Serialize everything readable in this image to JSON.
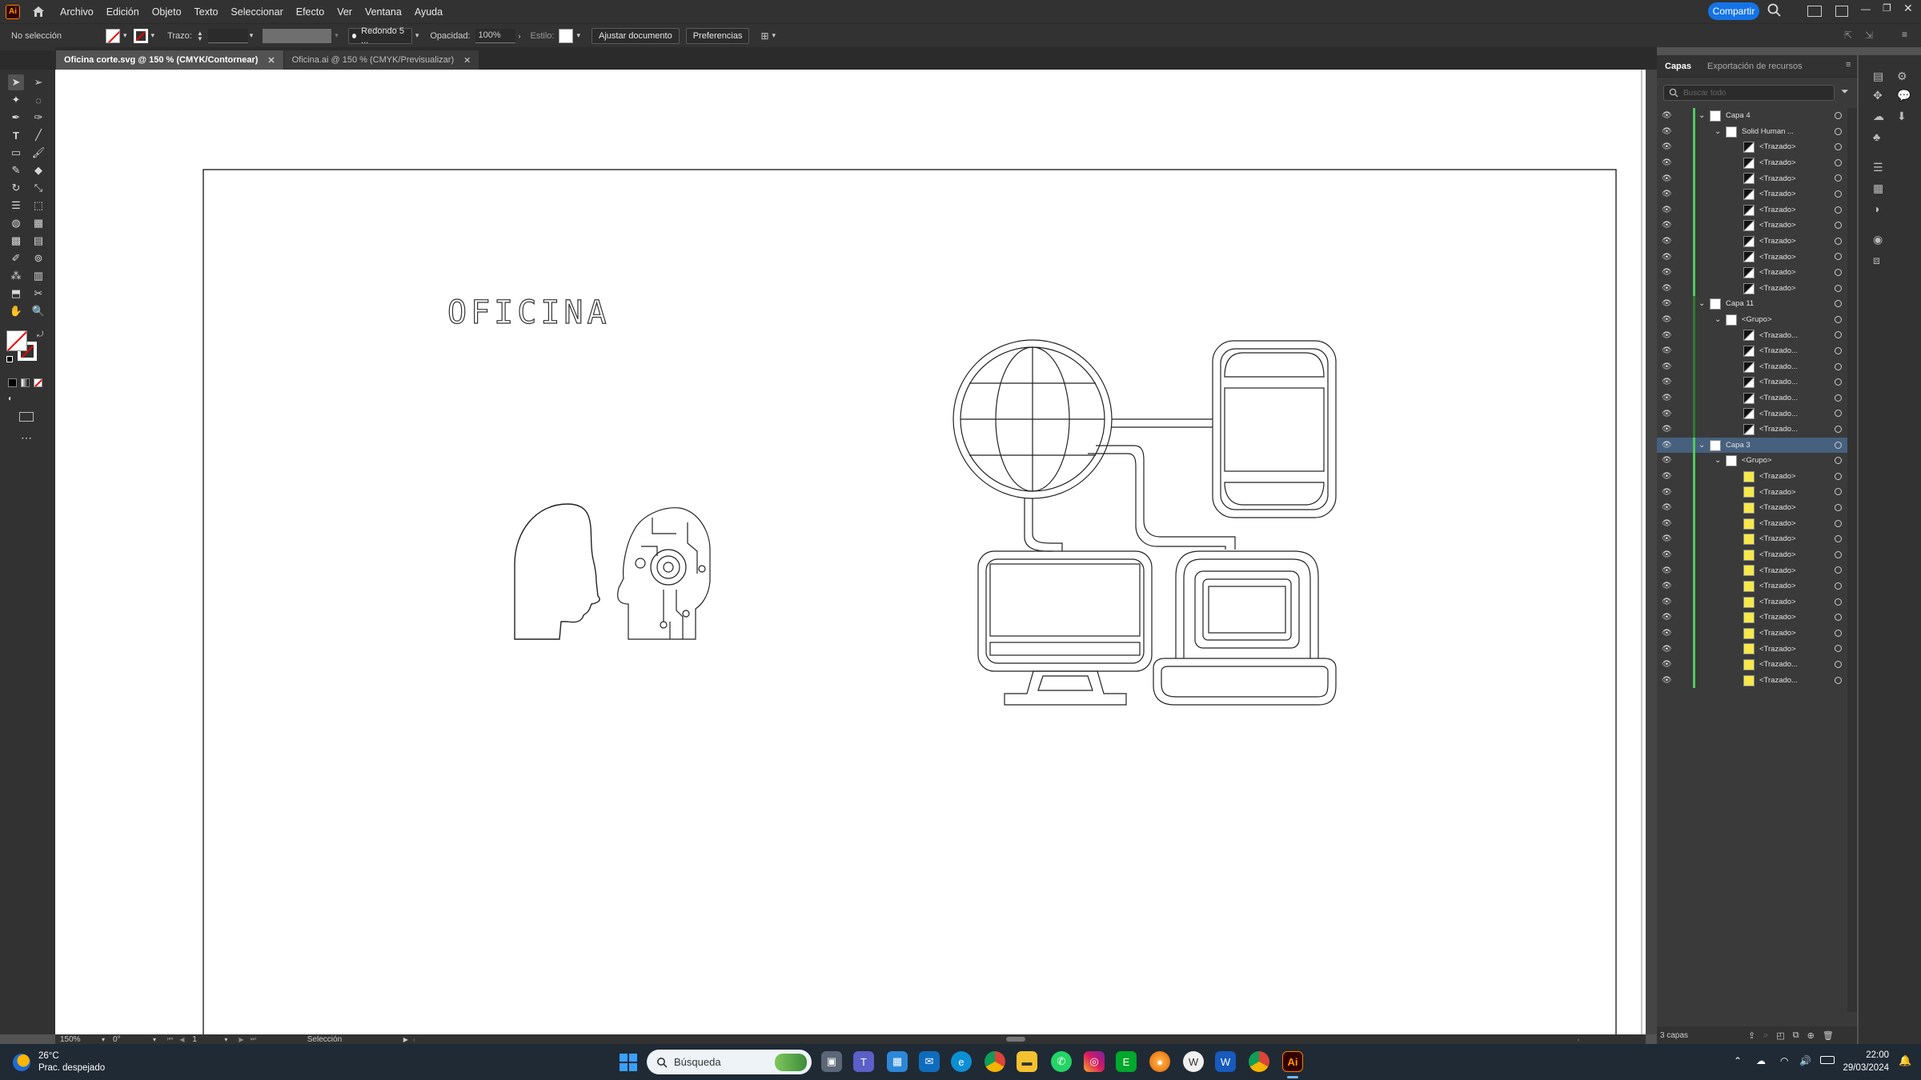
{
  "menubar": {
    "app_logo": "Ai",
    "items": [
      "Archivo",
      "Edición",
      "Objeto",
      "Texto",
      "Seleccionar",
      "Efecto",
      "Ver",
      "Ventana",
      "Ayuda"
    ],
    "share_label": "Compartir"
  },
  "control_bar": {
    "selection_status": "No selección",
    "stroke_label": "Trazo:",
    "brush_label": "Redondo 5 ...",
    "opacity_label": "Opacidad:",
    "opacity_value": "100%",
    "style_label": "Estilo:",
    "adjust_doc_label": "Ajustar documento",
    "preferences_label": "Preferencias"
  },
  "tabs": [
    {
      "label": "Oficina corte.svg @ 150 % (CMYK/Contornear)",
      "active": true
    },
    {
      "label": "Oficina.ai @ 150 % (CMYK/Previsualizar)",
      "active": false
    }
  ],
  "artboard": {
    "title_text": "OFICINA"
  },
  "layers_panel": {
    "tabs": [
      "Capas",
      "Exportación de recursos"
    ],
    "search_placeholder": "Buscar todo",
    "rows": [
      {
        "label": "Capa 4",
        "level": 0,
        "expanded": true,
        "color": "#4fc95c",
        "selected": false
      },
      {
        "label": "Solid Human ...",
        "level": 1,
        "expanded": true,
        "color": "#4fc95c",
        "selected": false
      },
      {
        "label": "<Trazado>",
        "level": 2,
        "color": "#4fc95c",
        "selected": false
      },
      {
        "label": "<Trazado>",
        "level": 2,
        "color": "#4fc95c",
        "selected": false
      },
      {
        "label": "<Trazado>",
        "level": 2,
        "color": "#4fc95c",
        "selected": false
      },
      {
        "label": "<Trazado>",
        "level": 2,
        "color": "#4fc95c",
        "selected": false
      },
      {
        "label": "<Trazado>",
        "level": 2,
        "color": "#4fc95c",
        "selected": false
      },
      {
        "label": "<Trazado>",
        "level": 2,
        "color": "#4fc95c",
        "selected": false
      },
      {
        "label": "<Trazado>",
        "level": 2,
        "color": "#4fc95c",
        "selected": false
      },
      {
        "label": "<Trazado>",
        "level": 2,
        "color": "#4fc95c",
        "selected": false
      },
      {
        "label": "<Trazado>",
        "level": 2,
        "color": "#4fc95c",
        "selected": false
      },
      {
        "label": "<Trazado>",
        "level": 2,
        "color": "#4fc95c",
        "selected": false
      },
      {
        "label": "Capa 11",
        "level": 0,
        "expanded": true,
        "color": "#2e7d32",
        "selected": false
      },
      {
        "label": "<Grupo>",
        "level": 1,
        "expanded": true,
        "color": "#2e7d32",
        "selected": false
      },
      {
        "label": "<Trazado...",
        "level": 2,
        "color": "#2e7d32",
        "selected": false
      },
      {
        "label": "<Trazado...",
        "level": 2,
        "color": "#2e7d32",
        "selected": false
      },
      {
        "label": "<Trazado...",
        "level": 2,
        "color": "#2e7d32",
        "selected": false
      },
      {
        "label": "<Trazado...",
        "level": 2,
        "color": "#2e7d32",
        "selected": false
      },
      {
        "label": "<Trazado...",
        "level": 2,
        "color": "#2e7d32",
        "selected": false
      },
      {
        "label": "<Trazado...",
        "level": 2,
        "color": "#2e7d32",
        "selected": false
      },
      {
        "label": "<Trazado...",
        "level": 2,
        "color": "#2e7d32",
        "selected": false
      },
      {
        "label": "Capa 3",
        "level": 0,
        "expanded": true,
        "color": "#4fc95c",
        "selected": true
      },
      {
        "label": "<Grupo>",
        "level": 1,
        "expanded": true,
        "color": "#4fc95c",
        "selected": false
      },
      {
        "label": "<Trazado>",
        "level": 2,
        "color": "#4fc95c",
        "selected": false
      },
      {
        "label": "<Trazado>",
        "level": 2,
        "color": "#4fc95c",
        "selected": false
      },
      {
        "label": "<Trazado>",
        "level": 2,
        "color": "#4fc95c",
        "selected": false
      },
      {
        "label": "<Trazado>",
        "level": 2,
        "color": "#4fc95c",
        "selected": false
      },
      {
        "label": "<Trazado>",
        "level": 2,
        "color": "#4fc95c",
        "selected": false
      },
      {
        "label": "<Trazado>",
        "level": 2,
        "color": "#4fc95c",
        "selected": false
      },
      {
        "label": "<Trazado>",
        "level": 2,
        "color": "#4fc95c",
        "selected": false
      },
      {
        "label": "<Trazado>",
        "level": 2,
        "color": "#4fc95c",
        "selected": false
      },
      {
        "label": "<Trazado>",
        "level": 2,
        "color": "#4fc95c",
        "selected": false
      },
      {
        "label": "<Trazado>",
        "level": 2,
        "color": "#4fc95c",
        "selected": false
      },
      {
        "label": "<Trazado>",
        "level": 2,
        "color": "#4fc95c",
        "selected": false
      },
      {
        "label": "<Trazado>",
        "level": 2,
        "color": "#4fc95c",
        "selected": false
      },
      {
        "label": "<Trazado...",
        "level": 2,
        "color": "#4fc95c",
        "selected": false
      },
      {
        "label": "<Trazado...",
        "level": 2,
        "color": "#4fc95c",
        "selected": false
      }
    ],
    "footer_label": "3 capas"
  },
  "status_bar": {
    "zoom": "150%",
    "rotation": "0°",
    "artboard_number": "1",
    "tool_name": "Selección"
  },
  "taskbar": {
    "weather_temp": "26°C",
    "weather_desc": "Prac. despejado",
    "search_placeholder": "Búsqueda",
    "time": "22:00",
    "date": "29/03/2024"
  }
}
